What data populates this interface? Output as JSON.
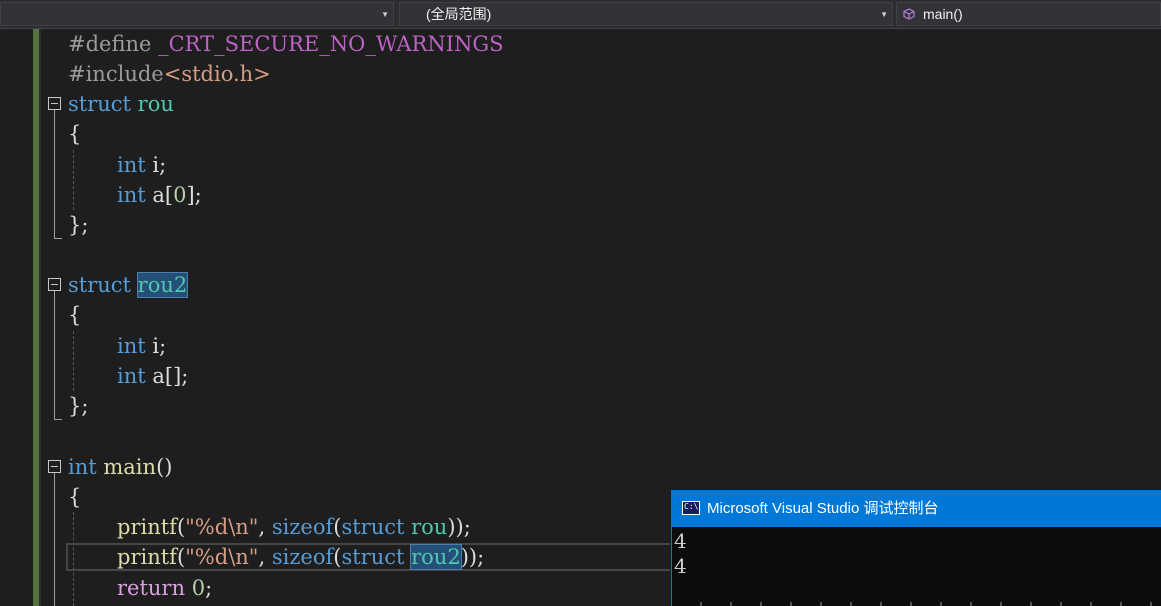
{
  "navbar": {
    "project_dropdown": "",
    "scope_dropdown": "(全局范围)",
    "member_dropdown": "main()"
  },
  "code": {
    "l1_a": "#define ",
    "l1_b": "_CRT_SECURE_NO_WARNINGS",
    "l2_a": "#include",
    "l2_b": "<stdio.h>",
    "l3_a": "struct",
    "l3_b": "rou",
    "l4": "{",
    "l5_a": "int",
    "l5_b": " i;",
    "l6_a": "int",
    "l6_b": " a[",
    "l6_c": "0",
    "l6_d": "];",
    "l7": "};",
    "l9_a": "struct",
    "l9_b": "rou2",
    "l10": "{",
    "l11_a": "int",
    "l11_b": " i;",
    "l12_a": "int",
    "l12_b": " a[];",
    "l13": "};",
    "l15_a": "int",
    "l15_b": "main",
    "l15_c": "()",
    "l16": "{",
    "l17_a": "printf",
    "l17_b": "(",
    "l17_c": "\"%d\\n\"",
    "l17_d": ", ",
    "l17_e": "sizeof",
    "l17_f": "(",
    "l17_g": "struct",
    "l17_h": "rou",
    "l17_i": "));",
    "l18_a": "printf",
    "l18_b": "(",
    "l18_c": "\"%d\\n\"",
    "l18_d": ", ",
    "l18_e": "sizeof",
    "l18_f": "(",
    "l18_g": "struct",
    "l18_h": "rou2",
    "l18_i": "));",
    "l19_a": "return",
    "l19_b": "0",
    "l19_c": ";"
  },
  "console": {
    "title": "Microsoft Visual Studio 调试控制台",
    "icon_text": "C:\\",
    "output": [
      "4",
      "4"
    ]
  },
  "colors": {
    "keyword": "#569cd6",
    "type": "#4ec9b0",
    "function": "#dcdcaa",
    "string": "#d69d85",
    "number": "#b5cea8",
    "console_title_bg": "#0078d7"
  }
}
